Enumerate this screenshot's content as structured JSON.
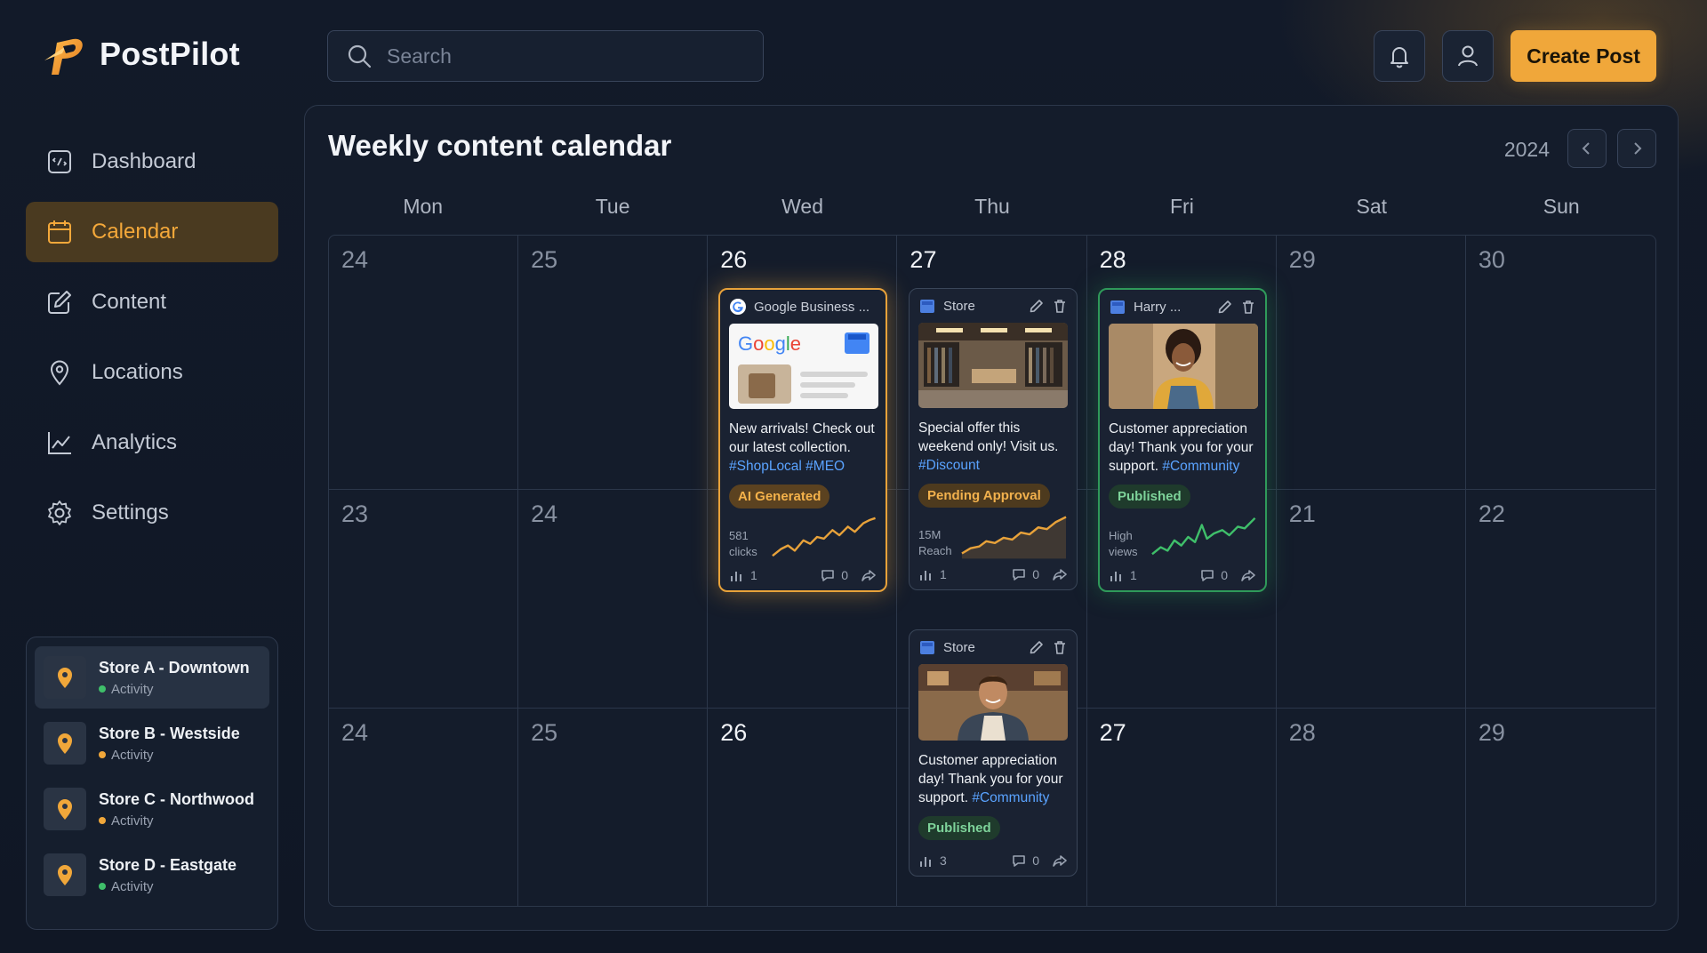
{
  "app": {
    "name": "PostPilot"
  },
  "search": {
    "placeholder": "Search"
  },
  "header": {
    "create_label": "Create Post"
  },
  "nav": [
    {
      "label": "Dashboard",
      "icon": "dashboard-icon"
    },
    {
      "label": "Calendar",
      "icon": "calendar-icon",
      "active": true
    },
    {
      "label": "Content",
      "icon": "edit-icon"
    },
    {
      "label": "Locations",
      "icon": "location-pin-icon"
    },
    {
      "label": "Analytics",
      "icon": "analytics-icon"
    },
    {
      "label": "Settings",
      "icon": "gear-icon"
    }
  ],
  "stores": [
    {
      "name": "Store A - Downtown",
      "status": "Activity",
      "status_color": "#3fbf6a",
      "active": true
    },
    {
      "name": "Store B - Westside",
      "status": "Activity",
      "status_color": "#f0a73a"
    },
    {
      "name": "Store C - Northwood",
      "status": "Activity",
      "status_color": "#f0a73a"
    },
    {
      "name": "Store D - Eastgate",
      "status": "Activity",
      "status_color": "#3fbf6a"
    }
  ],
  "calendar": {
    "title": "Weekly content calendar",
    "year": "2024",
    "days": [
      "Mon",
      "Tue",
      "Wed",
      "Thu",
      "Fri",
      "Sat",
      "Sun"
    ],
    "weeks": [
      [
        "24",
        "25",
        "26",
        "27",
        "28",
        "29",
        "30"
      ],
      [
        "23",
        "24",
        "",
        "",
        "",
        "21",
        "22"
      ],
      [
        "24",
        "25",
        "26",
        "",
        "27",
        "28",
        "29"
      ]
    ]
  },
  "posts": {
    "wed": {
      "source": "Google Business ...",
      "text": "New arrivals! Check out our latest collection.",
      "tags": "#ShopLocal #MEO",
      "badge": "AI Generated",
      "metric_value": "581",
      "metric_label": "clicks",
      "stats": "1",
      "comments": "0"
    },
    "thu1": {
      "source": "Store",
      "text": "Special offer this weekend only! Visit us.",
      "tags": "#Discount",
      "badge": "Pending Approval",
      "metric_value": "15M",
      "metric_label": "Reach",
      "stats": "1",
      "comments": "0"
    },
    "fri": {
      "source": "Harry ...",
      "text": "Customer appreciation day! Thank you for your support.",
      "tags": "#Community",
      "badge": "Published",
      "metric_value": "High",
      "metric_label": "views",
      "stats": "1",
      "comments": "0"
    },
    "thu2": {
      "source": "Store",
      "text": "Customer appreciation day! Thank you for your support.",
      "tags": "#Community",
      "badge": "Published",
      "stats": "3",
      "comments": "0"
    }
  },
  "colors": {
    "accent": "#f0a73a",
    "published": "#2f9a5a",
    "hashtag": "#5aa3ff",
    "background": "#121a29"
  }
}
